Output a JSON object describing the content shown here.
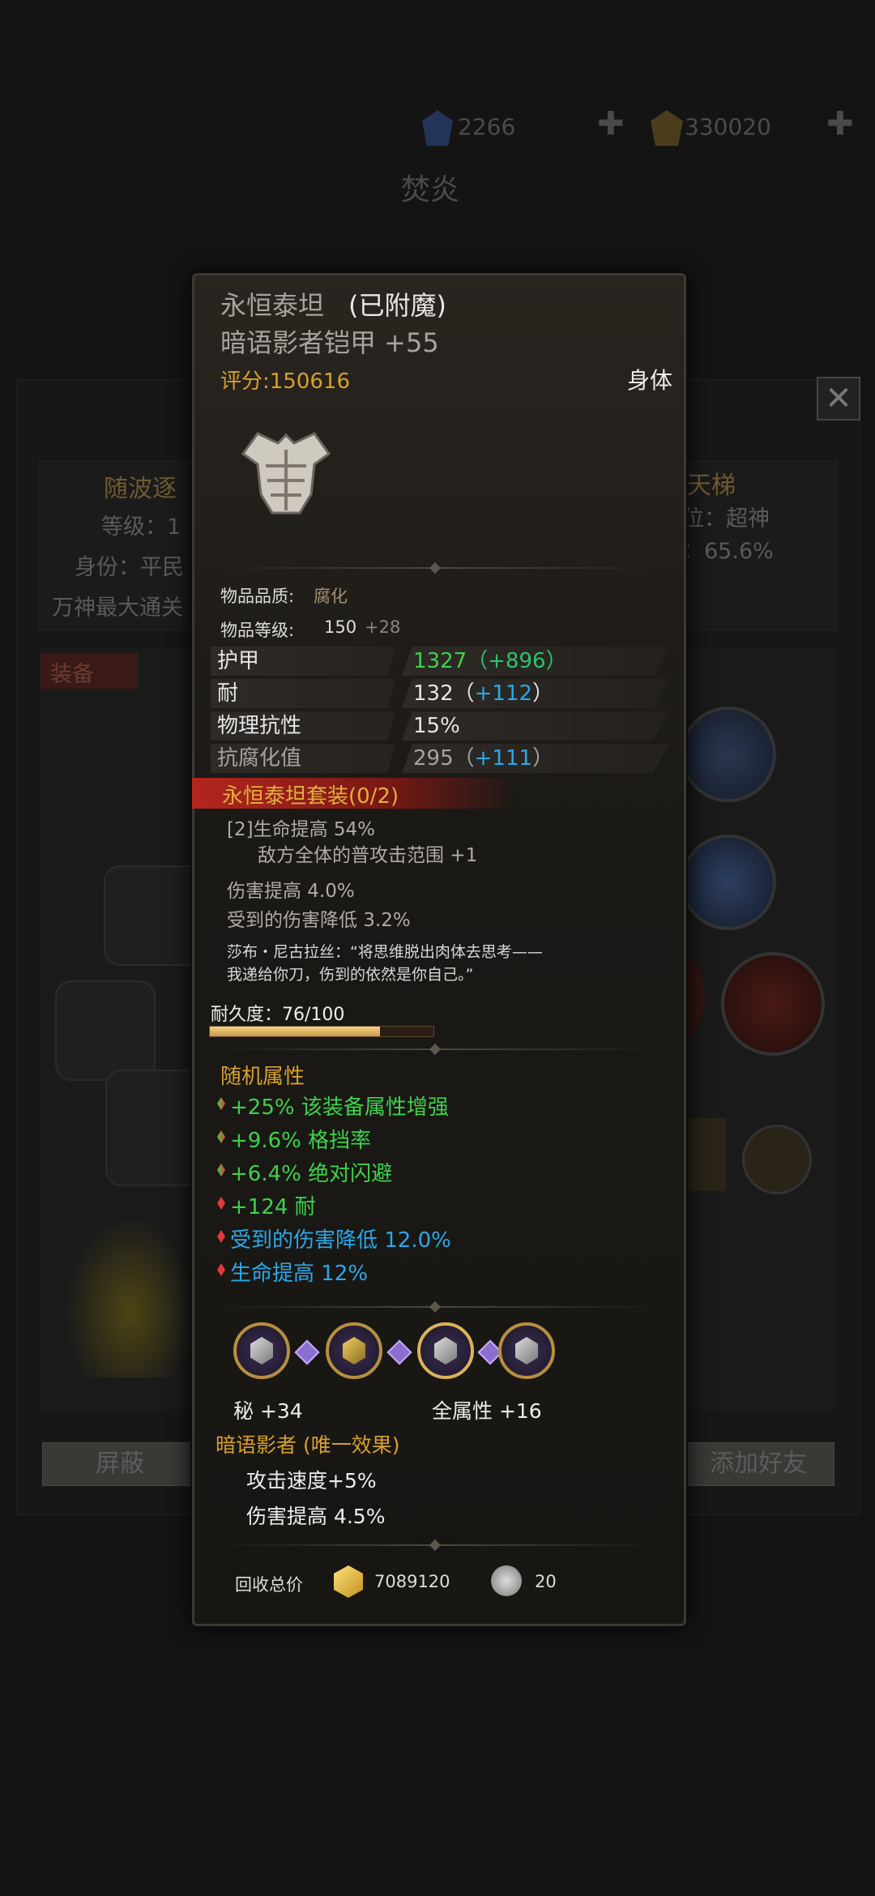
{
  "header": {
    "currency_blue": "2266",
    "currency_gold": "330020",
    "player_name": "焚炎"
  },
  "background_panel": {
    "left_name": "随波逐",
    "left_level": "等级：1",
    "left_identity": "身份：平民",
    "left_note": "万神最大通关",
    "right_name": "天梯",
    "right_rank": "位：超神",
    "right_pct": "：65.6%",
    "equip_tab": "装备",
    "block_button": "屏蔽",
    "add_friend_button": "添加好友"
  },
  "tooltip": {
    "name": "永恒泰坦",
    "enchanted": "(已附魔)",
    "item_name": "暗语影者铠甲 +55",
    "score": "评分:150616",
    "slot": "身体",
    "quality_label": "物品品质:",
    "quality_value": "腐化",
    "level_label": "物品等级:",
    "level_value": "150",
    "level_bonus": "+28",
    "stats": [
      {
        "label": "护甲",
        "base": "1327",
        "bonus": "（+896）",
        "color": "green"
      },
      {
        "label": "耐",
        "base": "132（",
        "bonus": "+112",
        "tail": "）",
        "color": "white"
      },
      {
        "label": "物理抗性",
        "base": "15%",
        "bonus": "",
        "tail": "",
        "color": "white"
      },
      {
        "label": "抗腐化值",
        "base": "295（",
        "bonus": "+111",
        "tail": "）",
        "color": "white"
      }
    ],
    "set_title": "永恒泰坦套装(0/2)",
    "set_bonus_1": "[2]生命提高 54%",
    "set_bonus_2": "敌方全体的普攻击范围 +1",
    "extra_1": "伤害提高 4.0%",
    "extra_2": "受到的伤害降低 3.2%",
    "flavor_1": "莎布・尼古拉丝：“将思维脱出肉体去思考——",
    "flavor_2": "我递给你刀，伤到的依然是你自己。”",
    "durability_label": "耐久度：76/100",
    "durability_fraction": 0.76,
    "random_title": "随机属性",
    "random_stats": [
      {
        "text": "+25% 该装备属性增强",
        "color": "green"
      },
      {
        "text": "+9.6% 格挡率",
        "color": "green"
      },
      {
        "text": "+6.4% 绝对闪避",
        "color": "green"
      },
      {
        "text": "+124 耐",
        "color": "green"
      },
      {
        "text": "受到的伤害降低 12.0%",
        "color": "cyan"
      },
      {
        "text": "生命提高 12%",
        "color": "cyan"
      }
    ],
    "socket_stat_1": "秘 +34",
    "socket_stat_2": "全属性 +16",
    "unique_title": "暗语影者 (唯一效果)",
    "unique_1": "攻击速度+5%",
    "unique_2": "伤害提高 4.5%",
    "recycle_label": "回收总价",
    "recycle_gold": "7089120",
    "recycle_other": "20"
  },
  "colors": {
    "accent_gold": "#d6a02e",
    "green": "#3fd14c",
    "cyan": "#2ba8e8",
    "set_red": "#b3261e"
  }
}
